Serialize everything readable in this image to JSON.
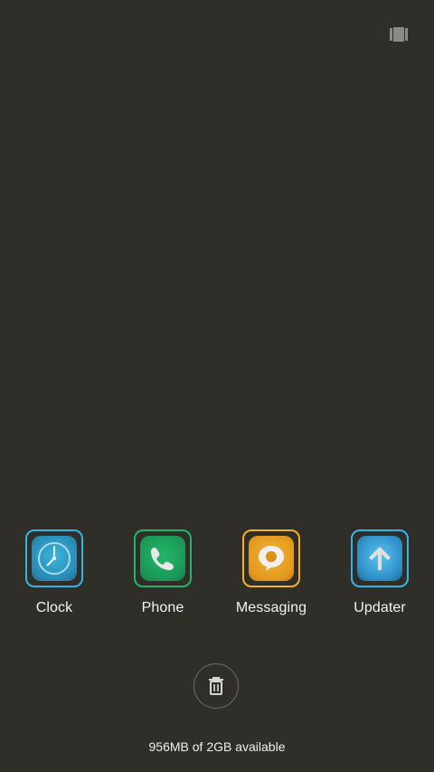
{
  "header": {
    "action_icon": "recents-list-icon"
  },
  "recent_apps": [
    {
      "label": "Clock",
      "icon": "clock-icon",
      "accent": "#35b5e5",
      "fill": "#2c8db8"
    },
    {
      "label": "Phone",
      "icon": "phone-icon",
      "accent": "#21b56b",
      "fill": "#1f9a5a"
    },
    {
      "label": "Messaging",
      "icon": "message-icon",
      "accent": "#f2b22c",
      "fill": "#e59b1f"
    },
    {
      "label": "Updater",
      "icon": "arrow-up-icon",
      "accent": "#35b5e5",
      "fill": "#2d8ec6"
    }
  ],
  "footer": {
    "memory_text": "956MB of 2GB available",
    "trash_icon": "trash-icon"
  },
  "colors": {
    "background": "#2f2e28",
    "text": "#f3f3f3",
    "trash_border": "#6c6b66"
  }
}
